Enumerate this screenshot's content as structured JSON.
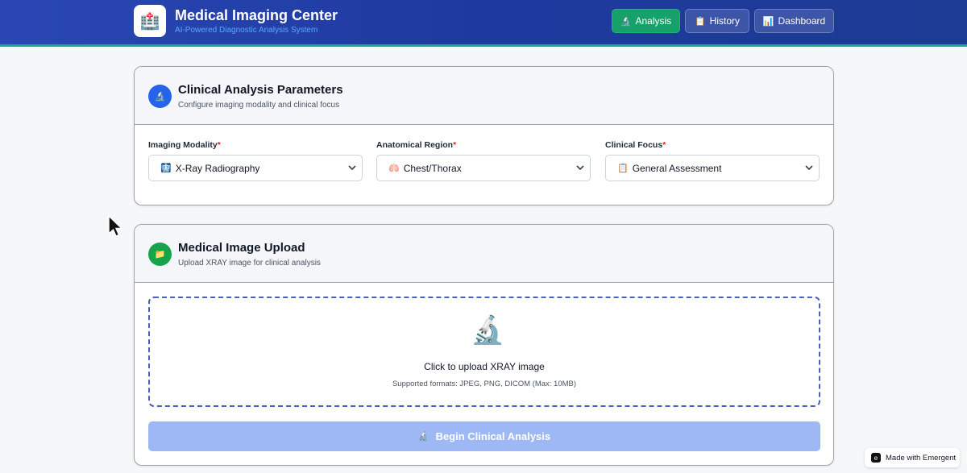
{
  "header": {
    "logo_emoji": "🏥",
    "title": "Medical Imaging Center",
    "subtitle": "AI-Powered Diagnostic Analysis System",
    "nav": [
      {
        "icon": "🔬",
        "label": "Analysis",
        "active": true
      },
      {
        "icon": "📋",
        "label": "History",
        "active": false
      },
      {
        "icon": "📊",
        "label": "Dashboard",
        "active": false
      }
    ]
  },
  "params": {
    "icon": "🔬",
    "title": "Clinical Analysis Parameters",
    "subtitle": "Configure imaging modality and clinical focus",
    "fields": [
      {
        "label": "Imaging Modality",
        "required": "*",
        "icon": "🩻",
        "value": "X-Ray Radiography"
      },
      {
        "label": "Anatomical Region",
        "required": "*",
        "icon": "🫁",
        "value": "Chest/Thorax"
      },
      {
        "label": "Clinical Focus",
        "required": "*",
        "icon": "📋",
        "value": "General Assessment"
      }
    ]
  },
  "upload": {
    "icon": "📁",
    "title": "Medical Image Upload",
    "subtitle": "Upload XRAY image for clinical analysis",
    "drop_icon": "🔬",
    "drop_text": "Click to upload XRAY image",
    "drop_hint": "Supported formats: JPEG, PNG, DICOM (Max: 10MB)",
    "button_icon": "🔬",
    "button_label": "Begin Clinical Analysis"
  },
  "badge": {
    "label": "Made with Emergent"
  },
  "colors": {
    "header": "#1e3a9f",
    "active_nav": "#16a06a",
    "params_icon": "#2563eb",
    "upload_icon": "#16a34a",
    "dropzone_border": "#4a5fc1",
    "button_disabled": "#9db8f5",
    "required": "#dc2626"
  }
}
